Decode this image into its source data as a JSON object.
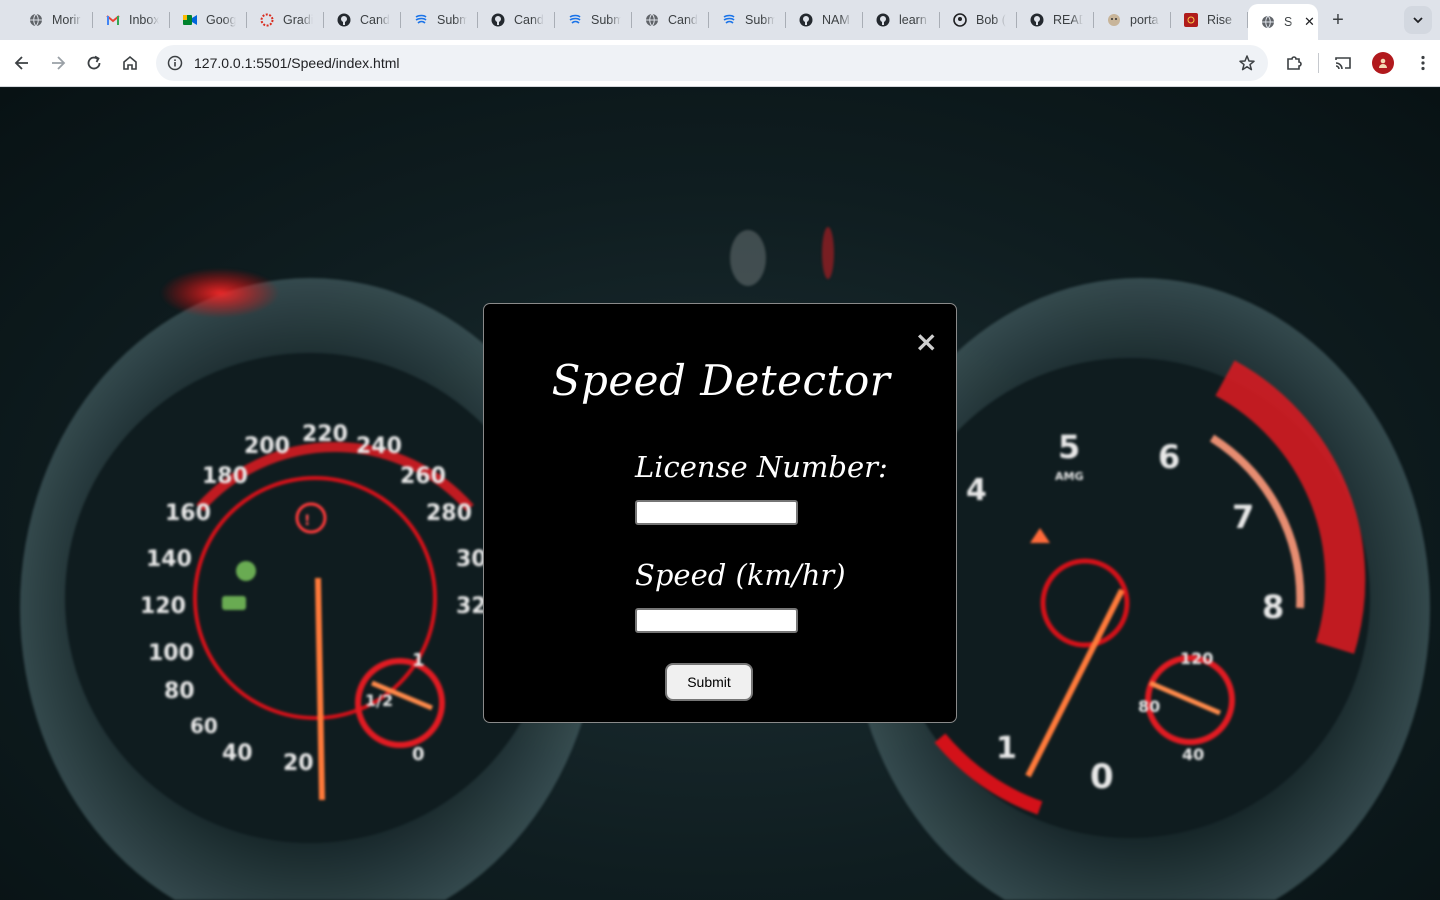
{
  "browser": {
    "tabs": [
      {
        "title": "Morir",
        "icon": "globe-icon"
      },
      {
        "title": "Inbox",
        "icon": "gmail-icon"
      },
      {
        "title": "Goog",
        "icon": "google-meet-icon"
      },
      {
        "title": "Gradi",
        "icon": "grading-icon"
      },
      {
        "title": "Cand",
        "icon": "github-icon"
      },
      {
        "title": "Subm",
        "icon": "submission-icon"
      },
      {
        "title": "Cand",
        "icon": "github-icon"
      },
      {
        "title": "Subm",
        "icon": "submission-icon"
      },
      {
        "title": "Cand",
        "icon": "globe-icon"
      },
      {
        "title": "Subm",
        "icon": "submission-icon"
      },
      {
        "title": "NAM",
        "icon": "github-icon"
      },
      {
        "title": "learn",
        "icon": "github-icon"
      },
      {
        "title": "Bob (",
        "icon": "profile-icon"
      },
      {
        "title": "READ",
        "icon": "github-icon"
      },
      {
        "title": "porta",
        "icon": "portal-icon"
      },
      {
        "title": "Rise",
        "icon": "rise-icon"
      }
    ],
    "active_tab": {
      "title": "S",
      "icon": "globe-icon"
    },
    "new_tab_label": "+",
    "url": "127.0.0.1:5501/Speed/index.html"
  },
  "modal": {
    "close_label": "×",
    "title": "Speed Detector",
    "license_label": "License Number:",
    "license_value": "",
    "speed_label": "Speed (km/hr)",
    "speed_value": "",
    "submit_label": "Submit"
  },
  "background": {
    "left_gauge_ticks": [
      "20",
      "40",
      "60",
      "80",
      "100",
      "120",
      "140",
      "160",
      "180",
      "200",
      "220",
      "240",
      "260",
      "280",
      "30",
      "32"
    ],
    "right_gauge_ticks": [
      "0",
      "1",
      "4",
      "5",
      "6",
      "7",
      "8"
    ],
    "sub_gauge_labels": [
      "1/2",
      "1",
      "0",
      "120",
      "80",
      "40"
    ],
    "brand_text": "AMG"
  },
  "colors": {
    "accent_red": "#d9131b",
    "needle": "#ff7a3a"
  }
}
